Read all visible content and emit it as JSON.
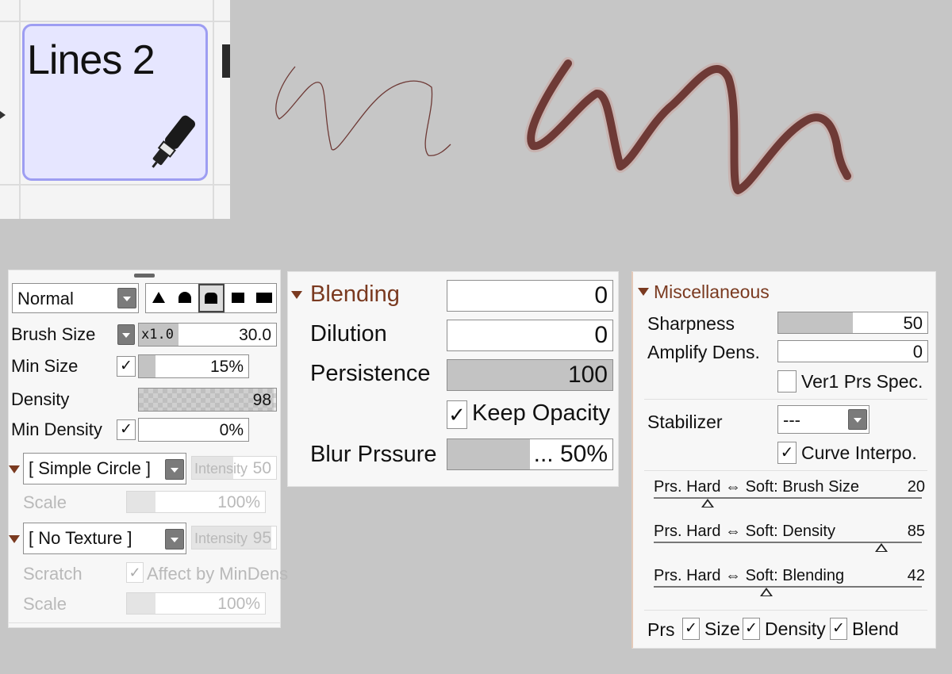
{
  "brush_tile": {
    "label": "Lines 2",
    "icon": "pen-icon"
  },
  "left_panel": {
    "blend_mode": "Normal",
    "brush_shapes": [
      "shape-sharp-icon",
      "shape-round-icon",
      "shape-flat-icon",
      "shape-square-icon",
      "shape-wide-icon"
    ],
    "brush_size": {
      "label": "Brush Size",
      "multiplier": "x1.0",
      "value": "30.0"
    },
    "min_size": {
      "label": "Min Size",
      "checked": "✓",
      "value": "15%",
      "fill": 0.15
    },
    "density": {
      "label": "Density",
      "value": "98",
      "fill": 0.98
    },
    "min_density": {
      "label": "Min Density",
      "checked": "✓",
      "value": "0%",
      "fill": 0
    },
    "shape_select": "[ Simple Circle ]",
    "shape_intensity": {
      "label": "Intensity",
      "value": "50"
    },
    "shape_scale": {
      "label": "Scale",
      "value": "100%"
    },
    "texture_select": "[ No Texture ]",
    "texture_intensity": {
      "label": "Intensity",
      "value": "95"
    },
    "scratch": {
      "label": "Scratch",
      "checked": "✓",
      "option": "Affect by MinDens"
    },
    "texture_scale": {
      "label": "Scale",
      "value": "100%"
    }
  },
  "middle_panel": {
    "blending": {
      "label": "Blending",
      "value": "0"
    },
    "dilution": {
      "label": "Dilution",
      "value": "0"
    },
    "persistence": {
      "label": "Persistence",
      "value": "100",
      "fill": 1.0
    },
    "keep_opacity": {
      "checked": "✓",
      "label": "Keep Opacity"
    },
    "blur_pressure": {
      "label": "Blur Prssure",
      "value": "... 50%",
      "fill": 0.5
    }
  },
  "right_panel": {
    "title": "Miscellaneous",
    "sharpness": {
      "label": "Sharpness",
      "value": "50",
      "fill": 0.5
    },
    "amplify": {
      "label": "Amplify Dens.",
      "value": "0"
    },
    "ver1": {
      "label": "Ver1 Prs Spec.",
      "checked": ""
    },
    "stabilizer": {
      "label": "Stabilizer",
      "value": "---"
    },
    "curve": {
      "checked": "✓",
      "label": "Curve Interpo."
    },
    "prs_sliders": [
      {
        "label": "Prs. Hard ⇔ Soft: Brush Size",
        "value": "20",
        "position": 0.2
      },
      {
        "label": "Prs. Hard ⇔ Soft: Density",
        "value": "85",
        "position": 0.85
      },
      {
        "label": "Prs. Hard ⇔ Soft: Blending",
        "value": "42",
        "position": 0.42
      }
    ],
    "prs": {
      "label": "Prs",
      "size": "Size",
      "density": "Density",
      "blend": "Blend",
      "checked": "✓"
    }
  },
  "colors": {
    "stroke": "#6e3a36",
    "accent": "#7a3a20",
    "tile_border": "#9d9df2",
    "tile_fill": "#e6e6ff"
  }
}
